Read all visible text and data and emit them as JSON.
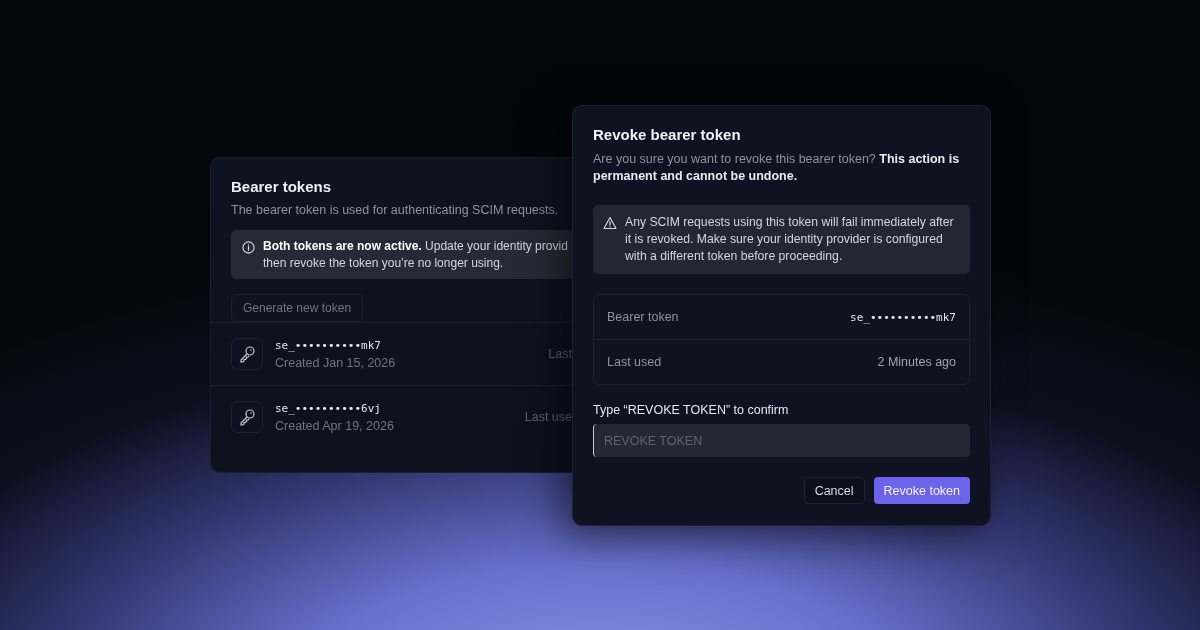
{
  "tokens_card": {
    "title": "Bearer tokens",
    "description": "The bearer token is used for authenticating SCIM requests.",
    "notice_lines": [
      "**Both tokens are now active.** Update your identity provid",
      "then revoke the token you’re no longer using."
    ],
    "generate_button": "Generate new token",
    "tokens": [
      {
        "token": "se_••••••••••mk7",
        "created": "Created Jan 15, 2026",
        "last_used": "Last"
      },
      {
        "token": "se_••••••••••6vj",
        "created": "Created Apr 19, 2026",
        "last_used": "Last use"
      }
    ]
  },
  "revoke_dialog": {
    "title": "Revoke bearer token",
    "description": "Are you sure you want to revoke this bearer token? **This action is permanent and cannot be undone.**",
    "warning": "Any SCIM requests using this token will fail immediately after it is revoked. Make sure your identity provider is configured with a different token before proceeding.",
    "details": [
      {
        "label": "Bearer token",
        "value": "se_••••••••••mk7",
        "kind": "mono"
      },
      {
        "label": "Last used",
        "value": "2 Minutes ago",
        "kind": "plain"
      }
    ],
    "confirm_label": "Type “REVOKE TOKEN” to confirm",
    "confirm_placeholder": "REVOKE TOKEN",
    "buttons": [
      {
        "label": "Cancel",
        "kind": "secondary"
      },
      {
        "label": "Revoke token",
        "kind": "primary"
      }
    ]
  }
}
